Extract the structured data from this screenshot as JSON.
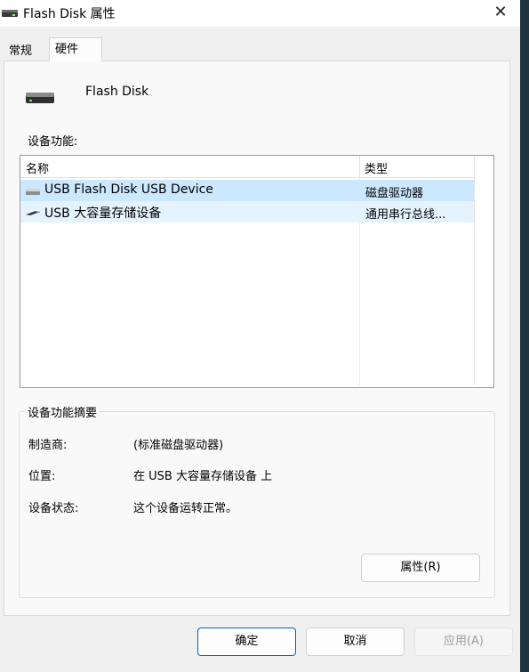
{
  "window": {
    "title": "Flash Disk 属性",
    "close_glyph": "✕"
  },
  "tabs": [
    {
      "label": "常规"
    },
    {
      "label": "硬件"
    }
  ],
  "device": {
    "name": "Flash Disk",
    "icon": "drive-icon"
  },
  "functions": {
    "label": "设备功能:",
    "columns": {
      "name": "名称",
      "type": "类型"
    },
    "rows": [
      {
        "name": "USB Flash Disk USB Device",
        "type": "磁盘驱动器",
        "icon": "disk-drive-icon"
      },
      {
        "name": "USB 大容量存储设备",
        "type": "通用串行总线...",
        "icon": "usb-icon"
      }
    ]
  },
  "summary": {
    "title": "设备功能摘要",
    "manufacturer_label": "制造商:",
    "manufacturer_value": "(标准磁盘驱动器)",
    "location_label": "位置:",
    "location_value": "在 USB 大容量存储设备 上",
    "status_label": "设备状态:",
    "status_value": "这个设备运转正常。",
    "properties_button": "属性(R)"
  },
  "buttons": {
    "ok": "确定",
    "cancel": "取消",
    "apply": "应用(A)"
  },
  "colors": {
    "selected_row": "#cce8ff",
    "hover_row": "#e5f3ff",
    "ok_border": "#0067c0"
  }
}
